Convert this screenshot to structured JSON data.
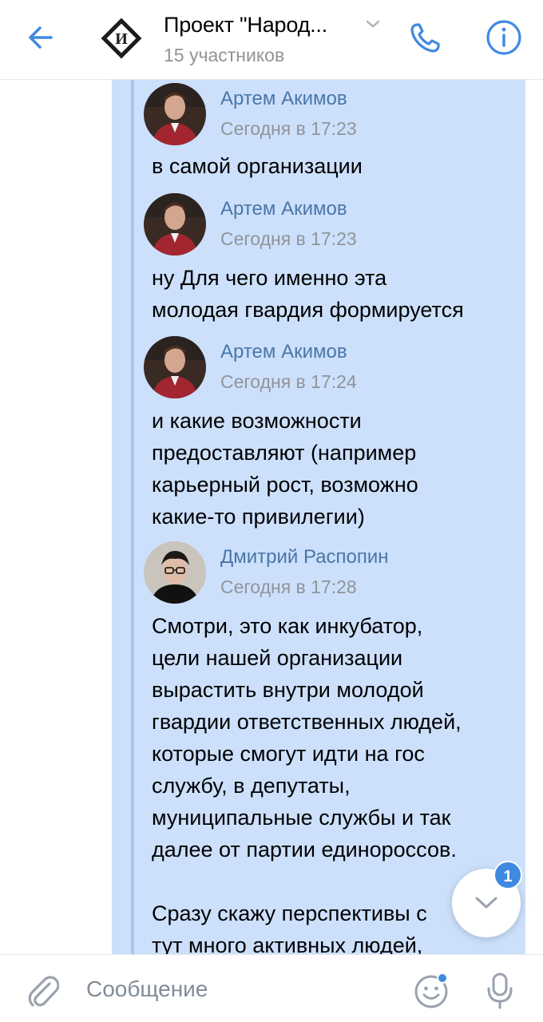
{
  "header": {
    "title": "Проект \"Народ...",
    "subtitle": "15 участников"
  },
  "messages": [
    {
      "author": "Артем Акимов",
      "time": "Сегодня в 17:23",
      "lines": [
        "в самой организации"
      ]
    },
    {
      "author": "Артем Акимов",
      "time": "Сегодня в 17:23",
      "lines": [
        "ну Для чего именно эта",
        "молодая гвардия формируется"
      ]
    },
    {
      "author": "Артем Акимов",
      "time": "Сегодня в 17:24",
      "lines": [
        "и какие возможности",
        "предоставляют (например",
        "карьерный рост, возможно",
        "какие-то привилегии)"
      ]
    },
    {
      "author": "Дмитрий Распопин",
      "time": "Сегодня в 17:28",
      "lines": [
        "Смотри, это как инкубатор,",
        "цели нашей организации",
        "вырастить внутри молодой",
        "гвардии ответственных людей,",
        "которые смогут идти на гос",
        "службу, в депутаты,",
        "муниципальные службы и так",
        "далее от партии единороссов.",
        "",
        "Сразу скажу перспективы с",
        "тут много активных людей,"
      ]
    }
  ],
  "scroll_badge": "1",
  "composer": {
    "placeholder": "Сообщение"
  },
  "colors": {
    "accent": "#3f8ae0",
    "highlight": "#cce0fb",
    "author": "#4a76a8"
  }
}
